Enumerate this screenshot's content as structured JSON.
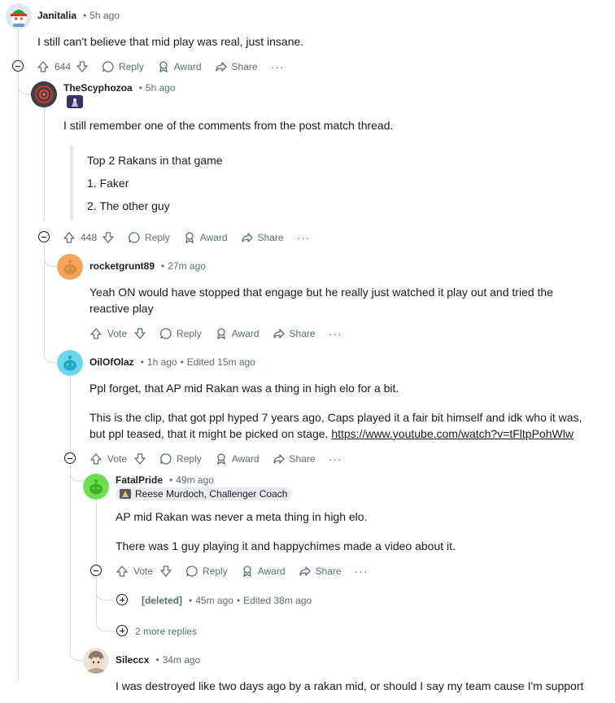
{
  "comments": {
    "c1": {
      "author": "Janitalia",
      "time": "5h ago",
      "body": "I still can't believe that mid play was real, just insane.",
      "votes": "644"
    },
    "c2": {
      "author": "TheScyphozoa",
      "time": "5h ago",
      "body": "I still remember one of the comments from the post match thread.",
      "quote": [
        "Top 2 Rakans in that game",
        "1. Faker",
        "2. The other guy"
      ],
      "votes": "448"
    },
    "c3": {
      "author": "rocketgrunt89",
      "time": "27m ago",
      "body_line1": "Yeah ON would have stopped that engage but he really just watched it play out and tried the",
      "body_line2": "reactive play"
    },
    "c4": {
      "author": "OilOfOlaz",
      "time": "1h ago",
      "edited": "Edited 15m ago",
      "body1": "Ppl forget, that AP mid Rakan was a thing in high elo for a bit.",
      "body2_line1": "This is the clip, that got ppl hyped 7 years ago, Caps played it a fair bit himself and idk who it was,",
      "body2_line2": "but ppl teased, that it might be picked on stage.",
      "link": "https://www.youtube.com/watch?v=tFltpPohWlw"
    },
    "c5": {
      "author": "FatalPride",
      "time": "49m ago",
      "flair": "Reese Murdoch, Challenger Coach",
      "body1": "AP mid Rakan was never a meta thing in high elo.",
      "body2": "There was 1 guy playing it and happychimes made a video about it."
    },
    "c6": {
      "author": "[deleted]",
      "time": "45m ago",
      "edited": "Edited 38m ago"
    },
    "more_replies": "2 more replies",
    "c7": {
      "author": "Sileccx",
      "time": "34m ago",
      "body": "I was destroyed like two days ago by a rakan mid, or should I say my team cause I'm support"
    }
  },
  "actions": {
    "vote": "Vote",
    "reply": "Reply",
    "award": "Award",
    "share": "Share",
    "more": "···"
  },
  "separator": "•",
  "colors": {
    "text": "#1c1c1c",
    "meta": "#576f76",
    "thread_line": "#d7dadc",
    "flair_bg": "#eaedef"
  }
}
